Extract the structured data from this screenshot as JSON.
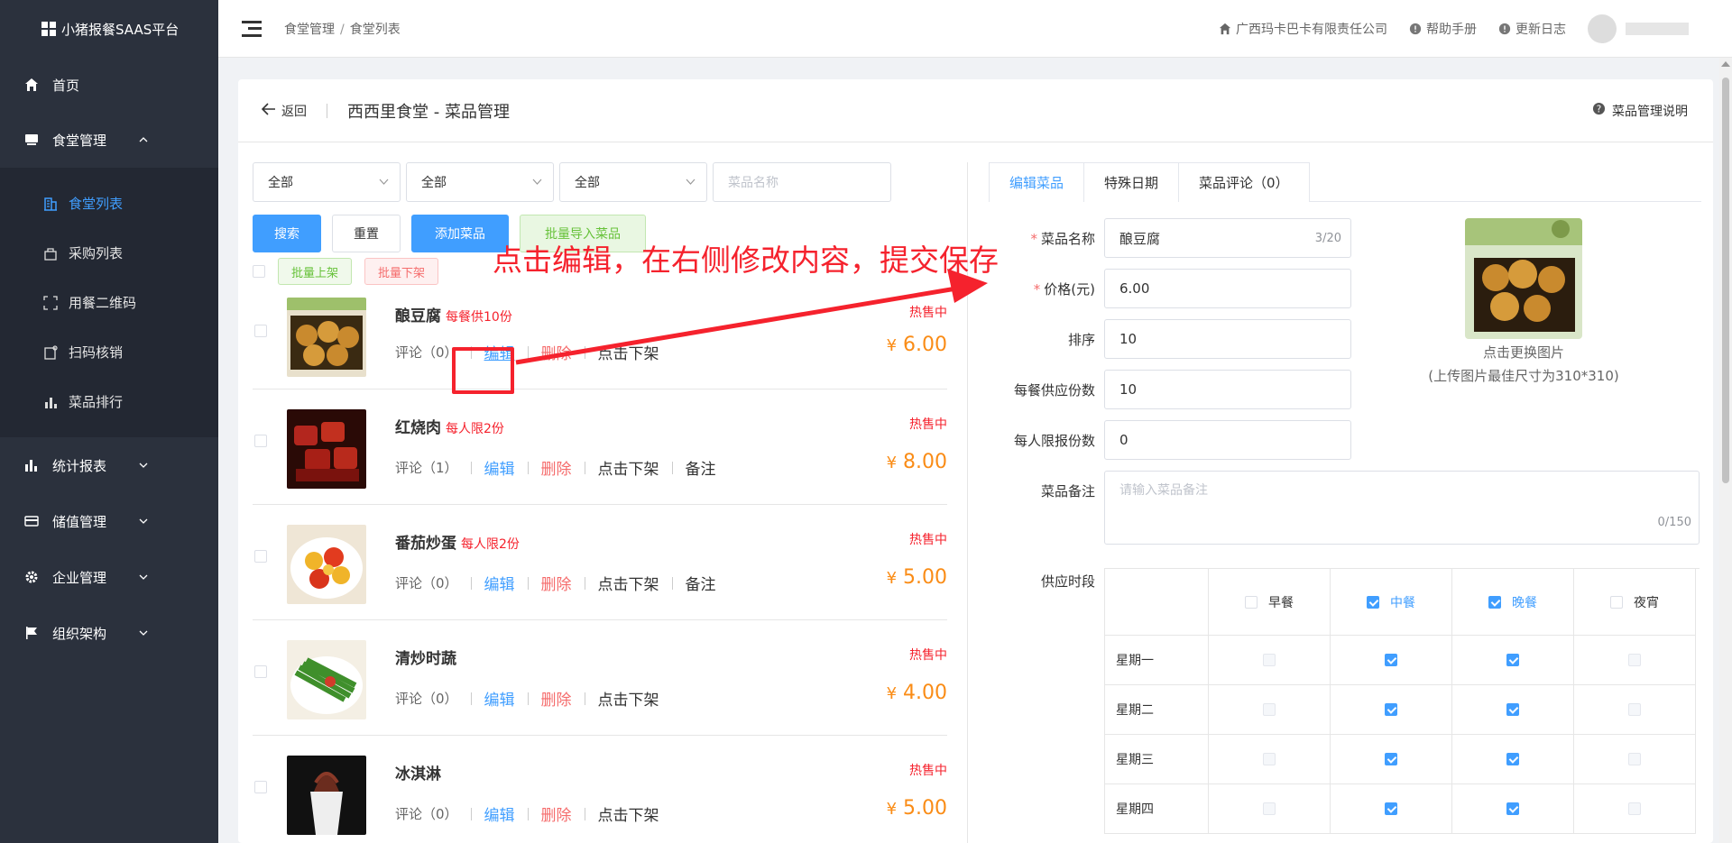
{
  "app": {
    "title": "小猪报餐SAAS平台"
  },
  "menu": {
    "home": "首页",
    "canteen": "食堂管理",
    "canteen_sub": [
      "食堂列表",
      "采购列表",
      "用餐二维码",
      "扫码核销",
      "菜品排行"
    ],
    "stats": "统计报表",
    "stored": "储值管理",
    "enterprise": "企业管理",
    "org": "组织架构"
  },
  "header": {
    "breadcrumb": [
      "食堂管理",
      "食堂列表"
    ],
    "breadcrumb_sep": "/",
    "company": "广西玛卡巴卡有限责任公司",
    "help": "帮助手册",
    "changelog": "更新日志"
  },
  "page": {
    "back": "返回",
    "title": "西西里食堂 - 菜品管理",
    "help": "菜品管理说明"
  },
  "filters": {
    "select1": "全部",
    "select2": "全部",
    "select3": "全部",
    "name_placeholder": "菜品名称"
  },
  "buttons": {
    "search": "搜索",
    "reset": "重置",
    "add": "添加菜品",
    "import": "批量导入菜品",
    "batch_on": "批量上架",
    "batch_off": "批量下架"
  },
  "dishes": [
    {
      "name": "酿豆腐",
      "limit": "每餐供10份",
      "status": "热售中",
      "comments": "评论（0）",
      "edit": "编辑",
      "delete": "删除",
      "off": "点击下架",
      "note": "",
      "price": "6.00",
      "currency": "¥"
    },
    {
      "name": "红烧肉",
      "limit": "每人限2份",
      "status": "热售中",
      "comments": "评论（1）",
      "edit": "编辑",
      "delete": "删除",
      "off": "点击下架",
      "note": "备注",
      "price": "8.00",
      "currency": "¥"
    },
    {
      "name": "番茄炒蛋",
      "limit": "每人限2份",
      "status": "热售中",
      "comments": "评论（0）",
      "edit": "编辑",
      "delete": "删除",
      "off": "点击下架",
      "note": "备注",
      "price": "5.00",
      "currency": "¥"
    },
    {
      "name": "清炒时蔬",
      "limit": "",
      "status": "热售中",
      "comments": "评论（0）",
      "edit": "编辑",
      "delete": "删除",
      "off": "点击下架",
      "note": "",
      "price": "4.00",
      "currency": "¥"
    },
    {
      "name": "冰淇淋",
      "limit": "",
      "status": "热售中",
      "comments": "评论（0）",
      "edit": "编辑",
      "delete": "删除",
      "off": "点击下架",
      "note": "",
      "price": "5.00",
      "currency": "¥"
    }
  ],
  "tabs": [
    "编辑菜品",
    "特殊日期",
    "菜品评论（0）"
  ],
  "form": {
    "name_label": "菜品名称",
    "name_value": "酿豆腐",
    "name_count": "3/20",
    "price_label": "价格(元)",
    "price_value": "6.00",
    "sort_label": "排序",
    "sort_value": "10",
    "supply_label": "每餐供应份数",
    "supply_value": "10",
    "limit_label": "每人限报份数",
    "limit_value": "0",
    "note_label": "菜品备注",
    "note_placeholder": "请输入菜品备注",
    "note_count": "0/150",
    "period_label": "供应时段",
    "upload_hint": "点击更换图片",
    "upload_size": "(上传图片最佳尺寸为310*310)"
  },
  "meals": [
    {
      "label": "早餐",
      "checked": false
    },
    {
      "label": "中餐",
      "checked": true
    },
    {
      "label": "晚餐",
      "checked": true
    },
    {
      "label": "夜宵",
      "checked": false
    }
  ],
  "weekdays": [
    "星期一",
    "星期二",
    "星期三",
    "星期四"
  ],
  "annotation": "点击编辑，在右侧修改内容，提交保存",
  "colors": {
    "primary": "#409eff",
    "danger": "#f5222d",
    "price": "#fa8c16",
    "sidebar": "#2b313d"
  }
}
